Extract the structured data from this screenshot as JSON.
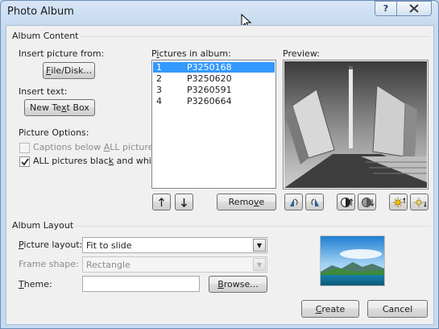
{
  "window": {
    "title": "Photo Album",
    "help_label": "?",
    "close_label": "X"
  },
  "album_content": {
    "group_label": "Album Content",
    "insert_picture_label": "Insert picture from:",
    "file_disk_button": {
      "pre": "",
      "u": "F",
      "post": "ile/Disk..."
    },
    "insert_text_label": "Insert text:",
    "new_text_box_button": {
      "pre": "New Te",
      "u": "x",
      "post": "t Box"
    },
    "picture_options_label": "Picture Options:",
    "captions_option": {
      "pre": "Captions below ",
      "u": "A",
      "post": "LL pictures",
      "checked": false,
      "enabled": false
    },
    "bw_option": {
      "pre": "ALL pictures blac",
      "u": "k",
      "post": " and white",
      "checked": true,
      "enabled": true
    }
  },
  "pictures": {
    "label_pre": "P",
    "label_u": "i",
    "label_post": "ctures in album:",
    "items": [
      {
        "num": "1",
        "name": "P3250168",
        "selected": true
      },
      {
        "num": "2",
        "name": "P3250620",
        "selected": false
      },
      {
        "num": "3",
        "name": "P3260591",
        "selected": false
      },
      {
        "num": "4",
        "name": "P3260664",
        "selected": false
      }
    ],
    "move_up_icon": "arrow-up-icon",
    "move_down_icon": "arrow-down-icon",
    "remove_button": {
      "pre": "Remo",
      "u": "v",
      "post": "e"
    }
  },
  "preview": {
    "label": "Preview:",
    "tools": [
      "rotate-left-icon",
      "rotate-right-icon",
      "contrast-up-icon",
      "contrast-down-icon",
      "brightness-up-icon",
      "brightness-down-icon"
    ]
  },
  "album_layout": {
    "group_label": "Album Layout",
    "picture_layout_label_pre": "",
    "picture_layout_label_u": "P",
    "picture_layout_label_post": "icture layout:",
    "picture_layout_value": "Fit to slide",
    "frame_shape_label": "Frame shape:",
    "frame_shape_value": "Rectangle",
    "theme_label_pre": "",
    "theme_label_u": "T",
    "theme_label_post": "heme:",
    "theme_value": "",
    "browse_button": {
      "pre": "",
      "u": "B",
      "post": "rowse..."
    }
  },
  "actions": {
    "create_button": {
      "pre": "",
      "u": "C",
      "post": "reate"
    },
    "cancel_button": "Cancel"
  },
  "colors": {
    "selection": "#3399ff",
    "title_bar": "#c6daf0",
    "dialog_bg": "#f0f0f0"
  }
}
